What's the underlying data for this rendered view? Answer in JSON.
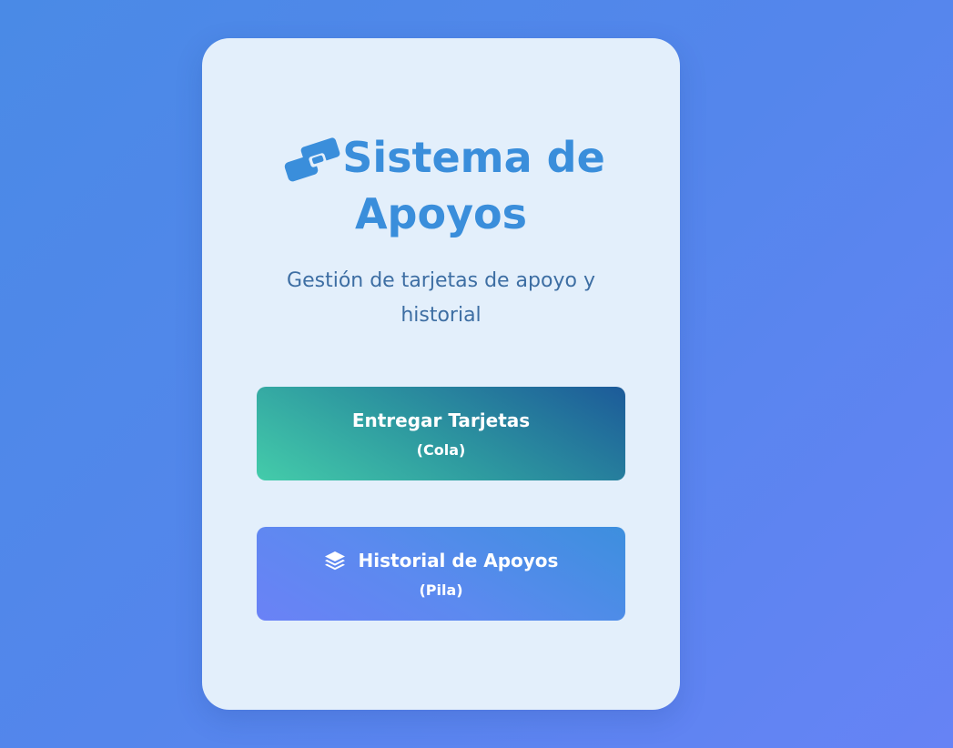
{
  "app": {
    "title_line1": "Sistema de",
    "title_line2": "Apoyos",
    "subtitle": "Gestión de tarjetas de apoyo y historial"
  },
  "icons": {
    "title_icon": "handshake-icon",
    "historial_icon": "layers-icon"
  },
  "buttons": {
    "entregar": {
      "label": "Entregar Tarjetas",
      "sublabel": "(Cola)"
    },
    "historial": {
      "label": "Historial de Apoyos",
      "sublabel": "(Pila)"
    }
  },
  "colors": {
    "background": "#5486ec",
    "card": "#e3effb",
    "accent": "#3a8edb",
    "subtitle_text": "#3d6ea3",
    "entregar_start": "#44ccaa",
    "entregar_end": "#1c5a99",
    "historial_start": "#6a82f6",
    "historial_end": "#3d8fde"
  }
}
